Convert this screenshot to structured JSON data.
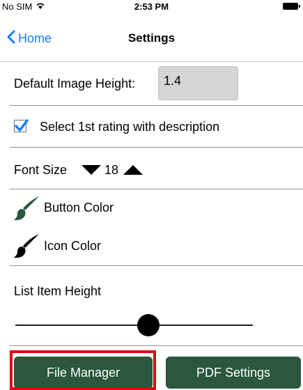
{
  "status_bar": {
    "carrier": "No SIM",
    "time": "2:53 PM",
    "wifi_icon": "wifi-icon",
    "battery_icon": "battery-icon"
  },
  "nav": {
    "back_label": "Home",
    "title": "Settings",
    "back_icon": "chevron-left-icon"
  },
  "settings": {
    "image_height_label": "Default Image Height:",
    "image_height_value": "1.4",
    "rating_label": "Select 1st rating with description",
    "rating_checked": true,
    "font_size_label": "Font Size",
    "font_size_value": "18",
    "button_color_label": "Button Color",
    "button_color": "#2a573d",
    "icon_color_label": "Icon Color",
    "icon_color": "#000000",
    "list_item_height_label": "List Item Height",
    "list_item_height_fraction": 0.56
  },
  "buttons": {
    "file_manager": "File Manager",
    "pdf_settings": "PDF Settings"
  },
  "colors": {
    "accent": "#147efb",
    "button_bg": "#2a573d",
    "highlight": "#e30613"
  }
}
